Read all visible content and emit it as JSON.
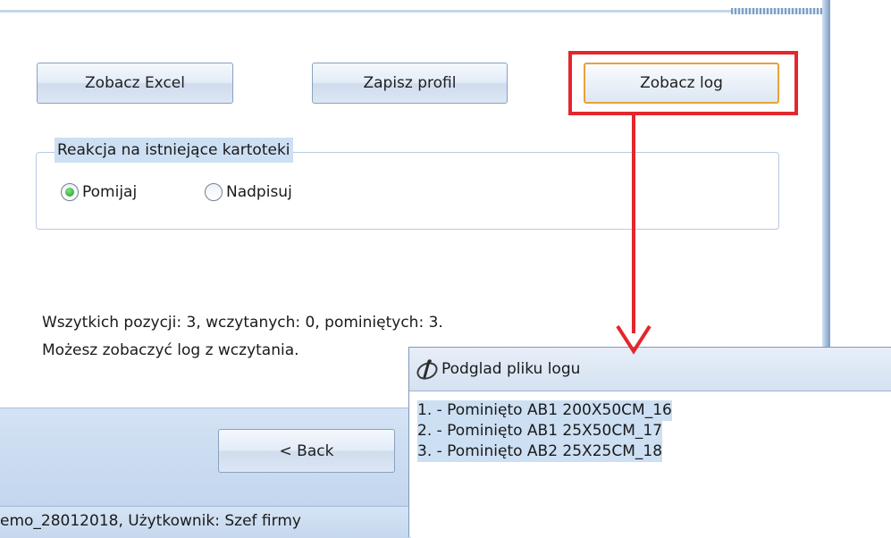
{
  "buttons": {
    "excel": "Zobacz Excel",
    "profile": "Zapisz profil",
    "log": "Zobacz log",
    "back": "<  Back"
  },
  "group": {
    "title": "Reakcja na istniejące kartoteki",
    "options": [
      {
        "label": "Pomijaj",
        "selected": true
      },
      {
        "label": "Nadpisuj",
        "selected": false
      }
    ]
  },
  "summary": {
    "line1": "Wszytkich pozycji: 3, wczytanych: 0, pominiętych: 3.",
    "line2": "Możesz zobaczyć log z wczytania."
  },
  "status_bar": {
    "text": "emo_28012018, Użytkownik: Szef firmy"
  },
  "log_window": {
    "title": "Podglad pliku logu",
    "lines": [
      "1. - Pominięto AB1 200X50CM_16",
      "2. - Pominięto AB1 25X50CM_17",
      "3. - Pominięto AB2 25X25CM_18"
    ]
  },
  "colors": {
    "highlight_red": "#e4262d",
    "focus_orange": "#e8a23a",
    "selection_blue": "#cddff3"
  }
}
